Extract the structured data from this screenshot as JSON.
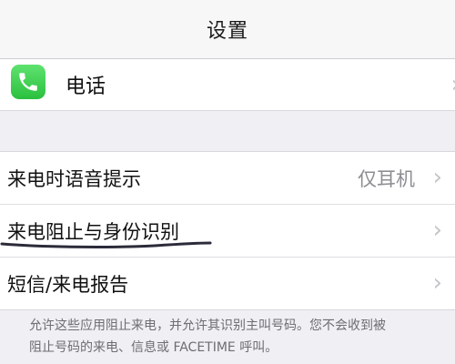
{
  "nav": {
    "title": "设置"
  },
  "phone_row": {
    "label": "电话",
    "icon": "phone-icon",
    "icon_color": "#34c759"
  },
  "settings": {
    "rows": [
      {
        "label": "来电时语音提示",
        "value": "仅耳机"
      },
      {
        "label": "来电阻止与身份识别",
        "value": ""
      },
      {
        "label": "短信/来电报告",
        "value": ""
      }
    ]
  },
  "footer": {
    "line1": "允许这些应用阻止来电，并允许其识别主叫号码。您不会收到被",
    "line2": "阻止号码的来电、信息或 FACETIME 呼叫。"
  },
  "colors": {
    "background": "#efeff4",
    "annotation": "#2b2b3a"
  }
}
